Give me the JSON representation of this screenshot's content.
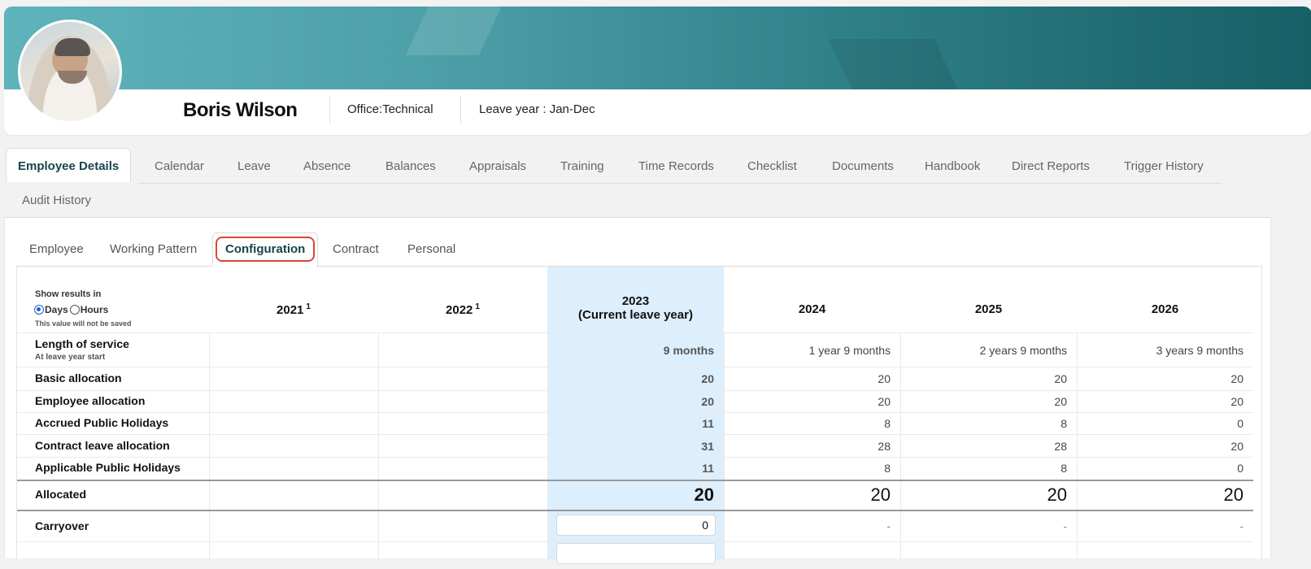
{
  "profile": {
    "name": "Boris Wilson",
    "office": "Office:Technical",
    "leave_year": "Leave year : Jan-Dec"
  },
  "main_tabs": [
    {
      "label": "Employee Details",
      "active": true
    },
    {
      "label": "Calendar"
    },
    {
      "label": "Leave"
    },
    {
      "label": "Absence"
    },
    {
      "label": "Balances"
    },
    {
      "label": "Appraisals"
    },
    {
      "label": "Training"
    },
    {
      "label": "Time Records"
    },
    {
      "label": "Checklist"
    },
    {
      "label": "Documents"
    },
    {
      "label": "Handbook"
    },
    {
      "label": "Direct Reports"
    },
    {
      "label": "Trigger History"
    },
    {
      "label": "Audit History"
    }
  ],
  "sub_tabs": [
    {
      "label": "Employee"
    },
    {
      "label": "Working Pattern"
    },
    {
      "label": "Configuration",
      "active": true
    },
    {
      "label": "Contract"
    },
    {
      "label": "Personal"
    }
  ],
  "units": {
    "label": "Show results in",
    "days": "Days",
    "hours": "Hours",
    "selected": "Days",
    "note": "This value will not be saved"
  },
  "columns": [
    {
      "year": "2021",
      "sup": "1"
    },
    {
      "year": "2022",
      "sup": "1"
    },
    {
      "year": "2023",
      "sub": "(Current leave year)"
    },
    {
      "year": "2024"
    },
    {
      "year": "2025"
    },
    {
      "year": "2026"
    }
  ],
  "rows": {
    "length_of_service": {
      "label": "Length of service",
      "sub": "At leave year start",
      "values": [
        "9 months",
        "1 year 9 months",
        "2 years 9 months",
        "3 years 9 months"
      ]
    },
    "basic_allocation": {
      "label": "Basic allocation",
      "values": [
        "20",
        "20",
        "20",
        "20"
      ]
    },
    "employee_allocation": {
      "label": "Employee allocation",
      "values": [
        "20",
        "20",
        "20",
        "20"
      ]
    },
    "accrued_public_holidays": {
      "label": "Accrued Public Holidays",
      "values": [
        "11",
        "8",
        "8",
        "0"
      ]
    },
    "contract_leave_allocation": {
      "label": "Contract leave allocation",
      "values": [
        "31",
        "28",
        "28",
        "20"
      ]
    },
    "applicable_public_holidays": {
      "label": "Applicable Public Holidays",
      "values": [
        "11",
        "8",
        "8",
        "0"
      ]
    },
    "allocated": {
      "label": "Allocated",
      "values": [
        "20",
        "20",
        "20",
        "20"
      ]
    },
    "carryover": {
      "label": "Carryover",
      "input_value": "0",
      "values": [
        "-",
        "-",
        "-"
      ]
    }
  },
  "colors": {
    "accent": "#17444c",
    "highlight_column": "#ddeefc",
    "focus_ring": "#d9473a",
    "banner_start": "#5fb3bb",
    "banner_end": "#165f66"
  }
}
